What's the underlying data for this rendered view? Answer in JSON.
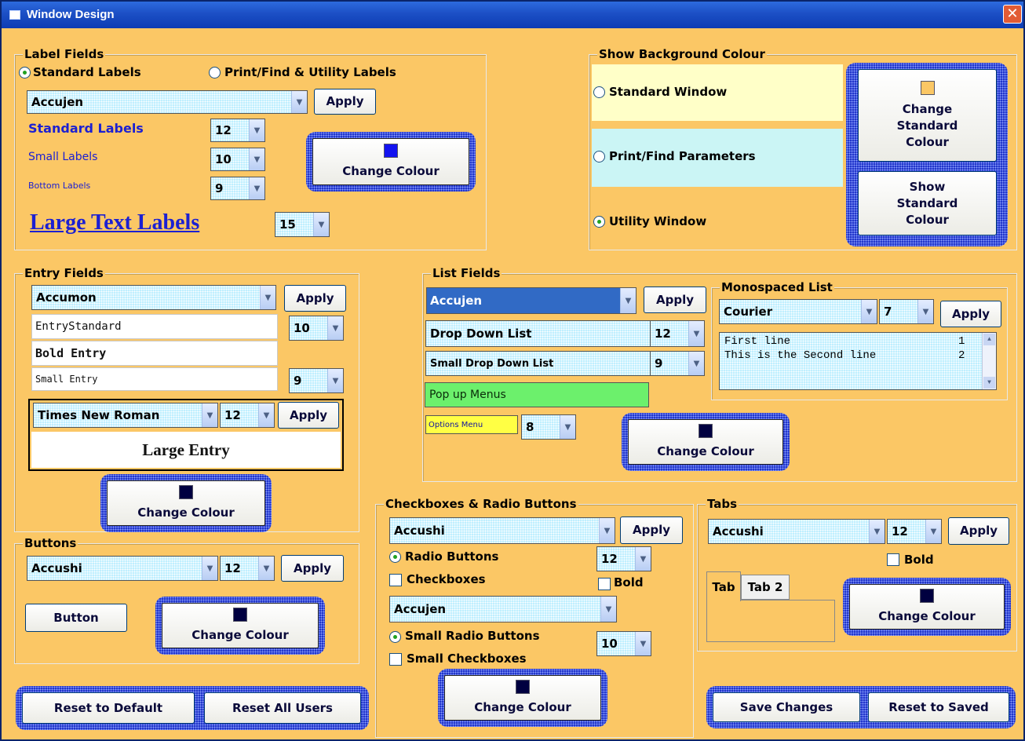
{
  "window": {
    "title": "Window Design",
    "close_glyph": "✕"
  },
  "common": {
    "apply": "Apply",
    "change_colour": "Change Colour",
    "arrow": "▼"
  },
  "label_fields": {
    "title": "Label Fields",
    "radio_standard": "Standard Labels",
    "radio_print": "Print/Find & Utility Labels",
    "font": "Accujen",
    "standard_label": "Standard Labels",
    "standard_size": "12",
    "small_label": "Small Labels",
    "small_size": "10",
    "bottom_label": "Bottom Labels",
    "bottom_size": "9",
    "large_label": "Large Text Labels",
    "large_size": "15",
    "colour": "#1313f0"
  },
  "background": {
    "title": "Show Background Colour",
    "standard_window": "Standard Window",
    "print_find": "Print/Find Parameters",
    "utility_window": "Utility Window",
    "change_standard_colour": [
      "Change",
      "Standard",
      "Colour"
    ],
    "show_standard_colour": [
      "Show",
      "Standard",
      "Colour"
    ],
    "swatch_colour": "#fbc765"
  },
  "entry_fields": {
    "title": "Entry Fields",
    "font": "Accumon",
    "standard_entry": "EntryStandard",
    "standard_size": "10",
    "bold_entry": "Bold Entry",
    "small_entry": "Small Entry",
    "small_size": "9",
    "large_font": "Times New Roman",
    "large_size": "12",
    "large_entry": "Large Entry",
    "colour": "#000040"
  },
  "list_fields": {
    "title": "List Fields",
    "font": "Accujen",
    "drop_down": "Drop Down List",
    "drop_down_size": "12",
    "small_drop_down": "Small Drop Down List",
    "small_drop_down_size": "9",
    "popup": "Pop up Menus",
    "options_menu": "Options Menu",
    "options_size": "8",
    "colour": "#000040"
  },
  "monospaced": {
    "title": "Monospaced List",
    "font": "Courier",
    "size": "7",
    "lines": [
      {
        "text": "First line",
        "num": "1"
      },
      {
        "text": "This is the Second line",
        "num": "2"
      }
    ]
  },
  "buttons": {
    "title": "Buttons",
    "font": "Accushi",
    "size": "12",
    "button": "Button",
    "colour": "#000040"
  },
  "checkboxes": {
    "title": "Checkboxes & Radio Buttons",
    "font": "Accushi",
    "size": "12",
    "radio_buttons": "Radio Buttons",
    "checkboxes": "Checkboxes",
    "bold": "Bold",
    "small_font": "Accujen",
    "small_radio": "Small Radio Buttons",
    "small_check": "Small Checkboxes",
    "small_size": "10",
    "colour": "#000040"
  },
  "tabs": {
    "title": "Tabs",
    "font": "Accushi",
    "size": "12",
    "bold": "Bold",
    "tab1": "Tab",
    "tab2": "Tab 2",
    "colour": "#000040"
  },
  "footer": {
    "reset_default": "Reset to Default",
    "reset_all": "Reset All Users",
    "save": "Save Changes",
    "reset_saved": "Reset to Saved"
  }
}
